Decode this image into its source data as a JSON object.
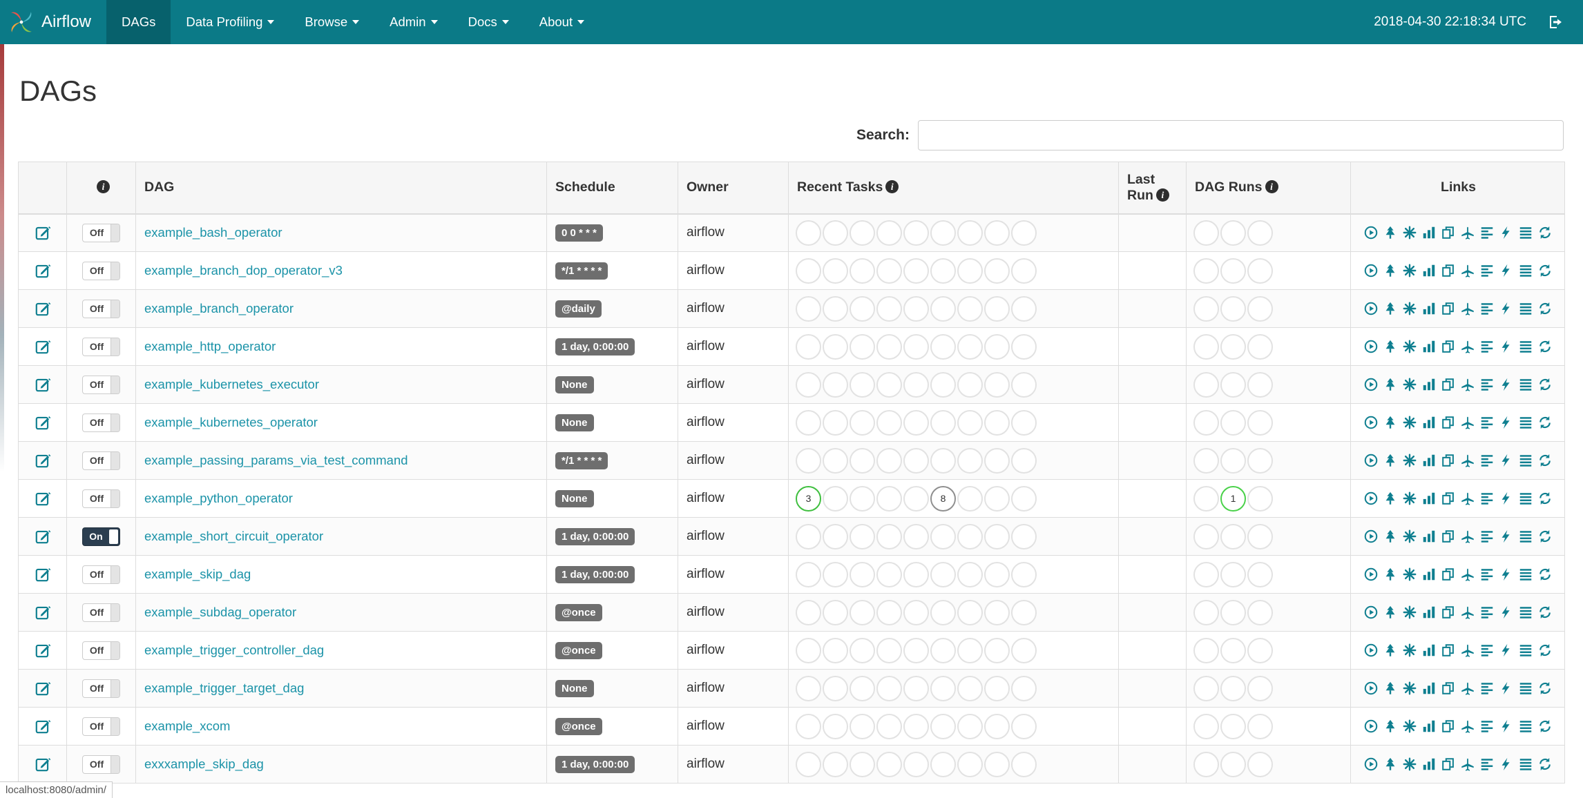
{
  "colors": {
    "navbar": "#0b7a87",
    "navbar_active": "#07616c",
    "link": "#1b93a8",
    "icon": "#0f7f90",
    "badge_bg": "#6e6e6e",
    "toggle_on_bg": "#2b3e50",
    "success_green": "#3fbf3f",
    "run_green": "#49d149",
    "neutral_grey": "#8f8f8f"
  },
  "navbar": {
    "brand": "Airflow",
    "timestamp": "2018-04-30 22:18:34 UTC",
    "items": [
      {
        "label": "DAGs",
        "active": true,
        "dropdown": false
      },
      {
        "label": "Data Profiling",
        "active": false,
        "dropdown": true
      },
      {
        "label": "Browse",
        "active": false,
        "dropdown": true
      },
      {
        "label": "Admin",
        "active": false,
        "dropdown": true
      },
      {
        "label": "Docs",
        "active": false,
        "dropdown": true
      },
      {
        "label": "About",
        "active": false,
        "dropdown": true
      }
    ]
  },
  "page": {
    "title": "DAGs",
    "search_label": "Search:",
    "status_url": "localhost:8080/admin/"
  },
  "table": {
    "headers": {
      "dag": "DAG",
      "schedule": "Schedule",
      "owner": "Owner",
      "recent": "Recent Tasks",
      "last_run": "Last Run",
      "dag_runs": "DAG Runs",
      "links": "Links"
    },
    "toggle": {
      "on": "On",
      "off": "Off"
    },
    "recent_slots": 9,
    "dag_run_slots": 3,
    "links": [
      "trigger-dag",
      "tree-view",
      "graph-view",
      "task-duration",
      "task-tries",
      "landing-times",
      "gantt",
      "code-view",
      "logs",
      "refresh"
    ],
    "rows": [
      {
        "name": "example_bash_operator",
        "schedule": "0 0 * * *",
        "owner": "airflow",
        "on": false,
        "recent": [],
        "dag_runs": []
      },
      {
        "name": "example_branch_dop_operator_v3",
        "schedule": "*/1 * * * *",
        "owner": "airflow",
        "on": false,
        "recent": [],
        "dag_runs": []
      },
      {
        "name": "example_branch_operator",
        "schedule": "@daily",
        "owner": "airflow",
        "on": false,
        "recent": [],
        "dag_runs": []
      },
      {
        "name": "example_http_operator",
        "schedule": "1 day, 0:00:00",
        "owner": "airflow",
        "on": false,
        "recent": [],
        "dag_runs": []
      },
      {
        "name": "example_kubernetes_executor",
        "schedule": "None",
        "owner": "airflow",
        "on": false,
        "recent": [],
        "dag_runs": []
      },
      {
        "name": "example_kubernetes_operator",
        "schedule": "None",
        "owner": "airflow",
        "on": false,
        "recent": [],
        "dag_runs": []
      },
      {
        "name": "example_passing_params_via_test_command",
        "schedule": "*/1 * * * *",
        "owner": "airflow",
        "on": false,
        "recent": [],
        "dag_runs": []
      },
      {
        "name": "example_python_operator",
        "schedule": "None",
        "owner": "airflow",
        "on": false,
        "recent": [
          {
            "slot": 0,
            "count": "3",
            "color": "#3fbf3f"
          },
          {
            "slot": 5,
            "count": "8",
            "color": "#8f8f8f"
          }
        ],
        "dag_runs": [
          {
            "slot": 1,
            "count": "1",
            "color": "#49d149"
          }
        ]
      },
      {
        "name": "example_short_circuit_operator",
        "schedule": "1 day, 0:00:00",
        "owner": "airflow",
        "on": true,
        "recent": [],
        "dag_runs": []
      },
      {
        "name": "example_skip_dag",
        "schedule": "1 day, 0:00:00",
        "owner": "airflow",
        "on": false,
        "recent": [],
        "dag_runs": []
      },
      {
        "name": "example_subdag_operator",
        "schedule": "@once",
        "owner": "airflow",
        "on": false,
        "recent": [],
        "dag_runs": []
      },
      {
        "name": "example_trigger_controller_dag",
        "schedule": "@once",
        "owner": "airflow",
        "on": false,
        "recent": [],
        "dag_runs": []
      },
      {
        "name": "example_trigger_target_dag",
        "schedule": "None",
        "owner": "airflow",
        "on": false,
        "recent": [],
        "dag_runs": []
      },
      {
        "name": "example_xcom",
        "schedule": "@once",
        "owner": "airflow",
        "on": false,
        "recent": [],
        "dag_runs": []
      },
      {
        "name": "exxxample_skip_dag",
        "schedule": "1 day, 0:00:00",
        "owner": "airflow",
        "on": false,
        "recent": [],
        "dag_runs": []
      }
    ]
  }
}
